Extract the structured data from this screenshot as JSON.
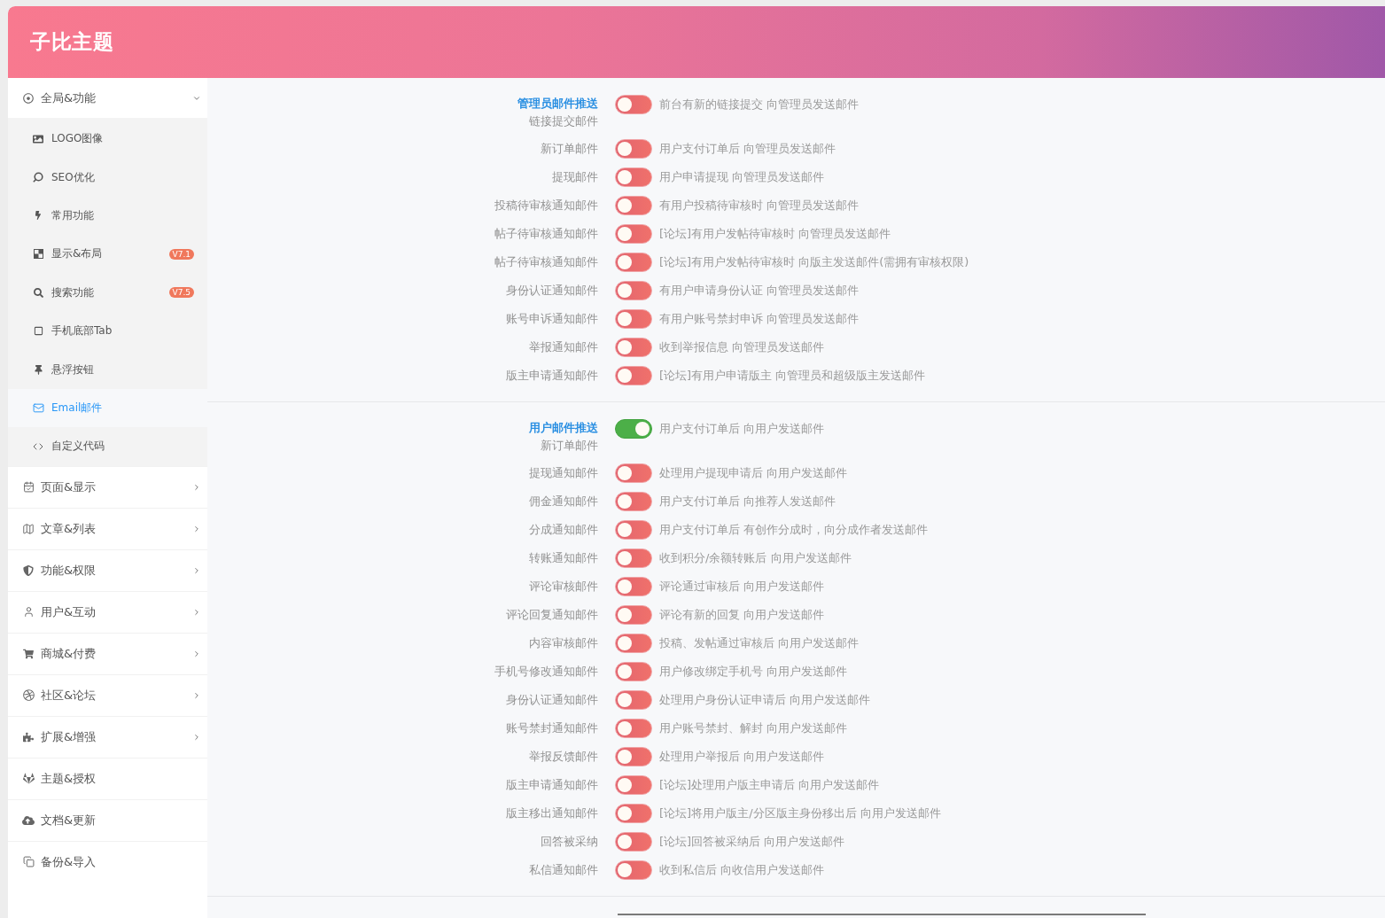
{
  "header": {
    "title": "子比主题"
  },
  "sidebar": {
    "items": [
      {
        "label": "全局&功能",
        "kind": "group",
        "expanded": true,
        "children": [
          {
            "label": "LOGO图像",
            "selected": false
          },
          {
            "label": "SEO优化",
            "selected": false
          },
          {
            "label": "常用功能",
            "selected": false
          },
          {
            "label": "显示&布局",
            "selected": false,
            "badge": "V7.1"
          },
          {
            "label": "搜索功能",
            "selected": false,
            "badge": "V7.5"
          },
          {
            "label": "手机底部Tab",
            "selected": false
          },
          {
            "label": "悬浮按钮",
            "selected": false
          },
          {
            "label": "Email邮件",
            "selected": true
          },
          {
            "label": "自定义代码",
            "selected": false
          }
        ]
      },
      {
        "label": "页面&显示",
        "kind": "group",
        "expanded": false
      },
      {
        "label": "文章&列表",
        "kind": "group",
        "expanded": false
      },
      {
        "label": "功能&权限",
        "kind": "group",
        "expanded": false
      },
      {
        "label": "用户&互动",
        "kind": "group",
        "expanded": false
      },
      {
        "label": "商城&付费",
        "kind": "group",
        "expanded": false
      },
      {
        "label": "社区&论坛",
        "kind": "group",
        "expanded": false
      },
      {
        "label": "扩展&增强",
        "kind": "group",
        "expanded": false
      },
      {
        "label": "主题&授权",
        "kind": "link"
      },
      {
        "label": "文档&更新",
        "kind": "link"
      },
      {
        "label": "备份&导入",
        "kind": "link"
      }
    ]
  },
  "sections": [
    {
      "title": "管理员邮件推送",
      "settings": [
        {
          "label": "链接提交邮件",
          "on": false,
          "description": "前台有新的链接提交 向管理员发送邮件"
        },
        {
          "label": "新订单邮件",
          "on": false,
          "description": "用户支付订单后 向管理员发送邮件"
        },
        {
          "label": "提现邮件",
          "on": false,
          "description": "用户申请提现 向管理员发送邮件"
        },
        {
          "label": "投稿待审核通知邮件",
          "on": false,
          "description": "有用户投稿待审核时 向管理员发送邮件"
        },
        {
          "label": "帖子待审核通知邮件",
          "on": false,
          "description": "[论坛]有用户发帖待审核时 向管理员发送邮件"
        },
        {
          "label": "帖子待审核通知邮件",
          "on": false,
          "description": "[论坛]有用户发帖待审核时 向版主发送邮件(需拥有审核权限)"
        },
        {
          "label": "身份认证通知邮件",
          "on": false,
          "description": "有用户申请身份认证 向管理员发送邮件"
        },
        {
          "label": "账号申诉通知邮件",
          "on": false,
          "description": "有用户账号禁封申诉 向管理员发送邮件"
        },
        {
          "label": "举报通知邮件",
          "on": false,
          "description": "收到举报信息 向管理员发送邮件"
        },
        {
          "label": "版主申请通知邮件",
          "on": false,
          "description": "[论坛]有用户申请版主 向管理员和超级版主发送邮件"
        }
      ]
    },
    {
      "title": "用户邮件推送",
      "settings": [
        {
          "label": "新订单邮件",
          "on": true,
          "description": "用户支付订单后 向用户发送邮件"
        },
        {
          "label": "提现通知邮件",
          "on": false,
          "description": "处理用户提现申请后 向用户发送邮件"
        },
        {
          "label": "佣金通知邮件",
          "on": false,
          "description": "用户支付订单后 向推荐人发送邮件"
        },
        {
          "label": "分成通知邮件",
          "on": false,
          "description": "用户支付订单后 有创作分成时，向分成作者发送邮件"
        },
        {
          "label": "转账通知邮件",
          "on": false,
          "description": "收到积分/余额转账后 向用户发送邮件"
        },
        {
          "label": "评论审核邮件",
          "on": false,
          "description": "评论通过审核后 向用户发送邮件"
        },
        {
          "label": "评论回复通知邮件",
          "on": false,
          "description": "评论有新的回复 向用户发送邮件"
        },
        {
          "label": "内容审核邮件",
          "on": false,
          "description": "投稿、发帖通过审核后 向用户发送邮件"
        },
        {
          "label": "手机号修改通知邮件",
          "on": false,
          "description": "用户修改绑定手机号 向用户发送邮件"
        },
        {
          "label": "身份认证通知邮件",
          "on": false,
          "description": "处理用户身份认证申请后 向用户发送邮件"
        },
        {
          "label": "账号禁封通知邮件",
          "on": false,
          "description": "用户账号禁封、解封 向用户发送邮件"
        },
        {
          "label": "举报反馈邮件",
          "on": false,
          "description": "处理用户举报后 向用户发送邮件"
        },
        {
          "label": "版主申请通知邮件",
          "on": false,
          "description": "[论坛]处理用户版主申请后 向用户发送邮件"
        },
        {
          "label": "版主移出通知邮件",
          "on": false,
          "description": "[论坛]将用户版主/分区版主身份移出后 向用户发送邮件"
        },
        {
          "label": "回答被采纳",
          "on": false,
          "description": "[论坛]回答被采纳后 向用户发送邮件"
        },
        {
          "label": "私信通知邮件",
          "on": false,
          "description": "收到私信后 向收信用户发送邮件"
        }
      ]
    }
  ]
}
